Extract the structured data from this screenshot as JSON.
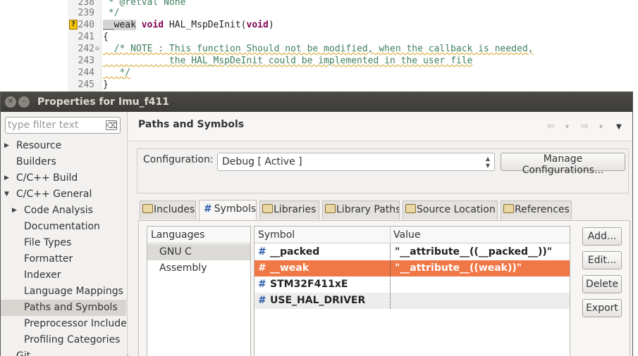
{
  "editor": {
    "lines": [
      {
        "num": "238",
        "code": " * @retval None",
        "type": "comment"
      },
      {
        "num": "239",
        "code": " */",
        "type": "comment"
      },
      {
        "num": "240",
        "code_kw_prefix": "__weak",
        "code_kw": "void",
        "code_rest": " HAL_MspDeInit(",
        "code_kw2": "void",
        "code_end": ")",
        "type": "decl"
      },
      {
        "num": "241",
        "code": "{",
        "type": "plain"
      },
      {
        "num": "242",
        "code": "  /* NOTE : This function Should not be modified, when the callback is needed,",
        "type": "comment"
      },
      {
        "num": "243",
        "code": "            the HAL_MspDeInit could be implemented in the user file",
        "type": "comment"
      },
      {
        "num": "244",
        "code": "   */",
        "type": "comment"
      },
      {
        "num": "245",
        "code": "}",
        "type": "plain"
      }
    ],
    "marker_glyph": "?",
    "fold_glyph": "⊖"
  },
  "dialog": {
    "title": "Properties for Imu_f411",
    "close_glyph": "✕",
    "min_glyph": "–"
  },
  "nav": {
    "filter_placeholder": "type filter text",
    "filter_clear_glyph": "⌫",
    "items": [
      {
        "label": "Resource",
        "arrow": "▶",
        "indent": 0
      },
      {
        "label": "Builders",
        "arrow": "",
        "indent": 0
      },
      {
        "label": "C/C++ Build",
        "arrow": "▶",
        "indent": 0
      },
      {
        "label": "C/C++ General",
        "arrow": "▼",
        "indent": 0
      },
      {
        "label": "Code Analysis",
        "arrow": "▶",
        "indent": 1
      },
      {
        "label": "Documentation",
        "arrow": "",
        "indent": 1
      },
      {
        "label": "File Types",
        "arrow": "",
        "indent": 1
      },
      {
        "label": "Formatter",
        "arrow": "",
        "indent": 1
      },
      {
        "label": "Indexer",
        "arrow": "",
        "indent": 1
      },
      {
        "label": "Language Mappings",
        "arrow": "",
        "indent": 1
      },
      {
        "label": "Paths and Symbols",
        "arrow": "",
        "indent": 1,
        "selected": true
      },
      {
        "label": "Preprocessor Include",
        "arrow": "",
        "indent": 1
      },
      {
        "label": "Profiling Categories",
        "arrow": "",
        "indent": 1
      },
      {
        "label": "Git",
        "arrow": "",
        "indent": 0
      }
    ]
  },
  "page": {
    "title": "Paths and Symbols",
    "back_glyph": "⇦",
    "forward_glyph": "⇨",
    "dropdown_glyph": "▾",
    "menu_glyph": "▼"
  },
  "config": {
    "label": "Configuration:",
    "value": "Debug  [ Active ]",
    "manage_label": "Manage Configurations..."
  },
  "tabs": [
    {
      "label": "Includes",
      "icon": "folder"
    },
    {
      "label": "Symbols",
      "icon": "hash",
      "active": true
    },
    {
      "label": "Libraries",
      "icon": "folder"
    },
    {
      "label": "Library Paths",
      "icon": "folder"
    },
    {
      "label": "Source Location",
      "icon": "folder"
    },
    {
      "label": "References",
      "icon": "folder"
    }
  ],
  "languages": {
    "header": "Languages",
    "items": [
      {
        "label": "GNU C",
        "selected": true
      },
      {
        "label": "Assembly"
      }
    ]
  },
  "symbols": {
    "col_symbol": "Symbol",
    "col_value": "Value",
    "hash_glyph": "#",
    "rows": [
      {
        "name": "__packed",
        "value": "\"__attribute__((__packed__))\""
      },
      {
        "name": "__weak",
        "value": "\"__attribute__((weak))\"",
        "selected": true
      },
      {
        "name": "STM32F411xE",
        "value": ""
      },
      {
        "name": "USE_HAL_DRIVER",
        "value": ""
      }
    ]
  },
  "actions": {
    "add": "Add...",
    "edit": "Edit...",
    "delete": "Delete",
    "export": "Export"
  },
  "colors": {
    "selection_accent": "#f07746",
    "titlebar": "#3c3b37"
  }
}
